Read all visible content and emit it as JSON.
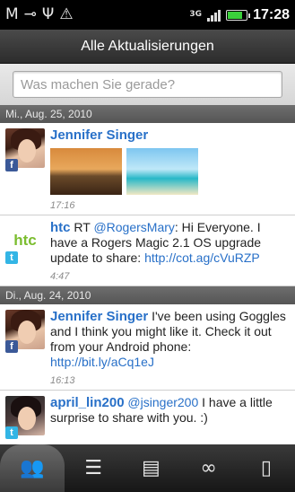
{
  "status_bar": {
    "left_icons": [
      "gmail-icon",
      "voicemail-icon",
      "usb-icon",
      "warning-icon"
    ],
    "network": "3G",
    "signal_bars": 4,
    "battery_level": 0.8,
    "time": "17:28"
  },
  "title": "Alle Aktualisierungen",
  "compose": {
    "placeholder": "Was machen Sie gerade?"
  },
  "feed": {
    "sections": [
      {
        "date": "Mi., Aug. 25, 2010"
      },
      {
        "date": "Di., Aug. 24, 2010"
      }
    ],
    "entries": [
      {
        "name": "Jennifer Singer",
        "text": "",
        "time": "17:16",
        "source": "f"
      },
      {
        "name": "htc",
        "text_before": " RT ",
        "mention": "@RogersMary",
        "text_after": ": Hi Everyone. I have a Rogers Magic 2.1 OS upgrade update to share: ",
        "link": "http://cot.ag/cVuRZP",
        "time": "4:47",
        "logo": "htc",
        "source": "t"
      },
      {
        "name": "Jennifer Singer",
        "text": " I've been using Goggles and I think you might like it. Check it out from your Android phone: ",
        "link": "http://bit.ly/aCq1eJ",
        "time": "16:13",
        "source": "f"
      },
      {
        "name": "april_lin200",
        "mention": " @jsinger200",
        "text": " I have a little surprise to share with you. :)",
        "time": "",
        "source": "t"
      }
    ]
  },
  "tabs": [
    {
      "icon": "people-icon",
      "glyph": "👥",
      "active": true
    },
    {
      "icon": "messages-icon",
      "glyph": "☰",
      "active": false
    },
    {
      "icon": "photos-icon",
      "glyph": "▤",
      "active": false
    },
    {
      "icon": "link-icon",
      "glyph": "∞",
      "active": false
    },
    {
      "icon": "contact-card-icon",
      "glyph": "▯",
      "active": false
    }
  ],
  "colors": {
    "link": "#2870c8",
    "htc_green": "#7bbd2f",
    "facebook": "#3b5998",
    "twitter": "#33b5e5"
  }
}
